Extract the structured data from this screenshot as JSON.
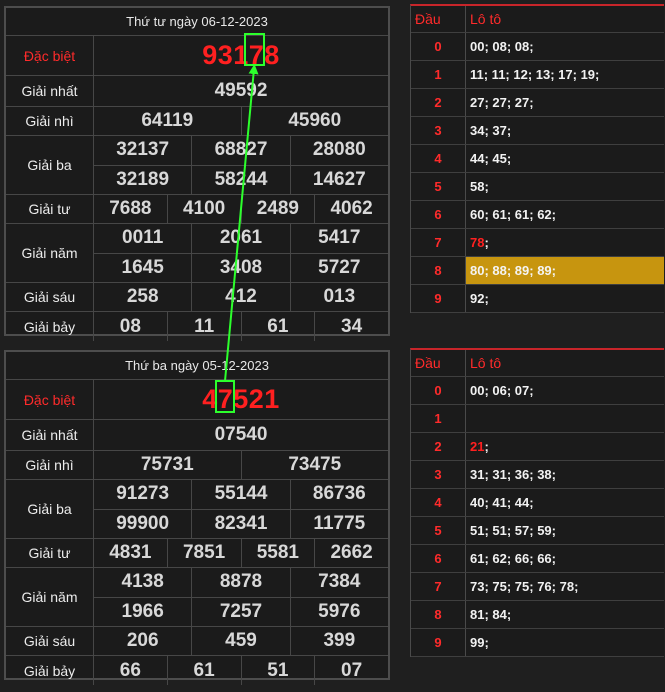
{
  "draws": [
    {
      "title": "Thứ tư ngày 06-12-2023",
      "rows": [
        {
          "label": "Đặc biệt",
          "values": [
            "93178"
          ]
        },
        {
          "label": "Giải nhất",
          "values": [
            "49592"
          ]
        },
        {
          "label": "Giải nhì",
          "values": [
            "64119",
            "45960"
          ]
        },
        {
          "label": "Giải ba",
          "values": [
            "32137",
            "68827",
            "28080",
            "32189",
            "58244",
            "14627"
          ]
        },
        {
          "label": "Giải tư",
          "values": [
            "7688",
            "4100",
            "2489",
            "4062"
          ]
        },
        {
          "label": "Giải năm",
          "values": [
            "0011",
            "2061",
            "5417",
            "1645",
            "3408",
            "5727"
          ]
        },
        {
          "label": "Giải sáu",
          "values": [
            "258",
            "412",
            "013"
          ]
        },
        {
          "label": "Giải bảy",
          "values": [
            "08",
            "11",
            "61",
            "34"
          ]
        }
      ],
      "loto": {
        "head_label": "Đầu",
        "values_label": "Lô tô",
        "rows": [
          {
            "dau": "0",
            "plain": "00; 08; 08;",
            "red": ""
          },
          {
            "dau": "1",
            "plain": "11; 11; 12; 13; 17; 19;",
            "red": ""
          },
          {
            "dau": "2",
            "plain": "27; 27; 27;",
            "red": ""
          },
          {
            "dau": "3",
            "plain": "34; 37;",
            "red": ""
          },
          {
            "dau": "4",
            "plain": "44; 45;",
            "red": ""
          },
          {
            "dau": "5",
            "plain": "58;",
            "red": ""
          },
          {
            "dau": "6",
            "plain": "60; 61; 61; 62;",
            "red": ""
          },
          {
            "dau": "7",
            "plain": ";",
            "red": "78"
          },
          {
            "dau": "8",
            "plain": "80; 88; 89; 89;",
            "red": ""
          },
          {
            "dau": "9",
            "plain": "92;",
            "red": ""
          }
        ]
      }
    },
    {
      "title": "Thứ ba ngày 05-12-2023",
      "rows": [
        {
          "label": "Đặc biệt",
          "values": [
            "47521"
          ]
        },
        {
          "label": "Giải nhất",
          "values": [
            "07540"
          ]
        },
        {
          "label": "Giải nhì",
          "values": [
            "75731",
            "73475"
          ]
        },
        {
          "label": "Giải ba",
          "values": [
            "91273",
            "55144",
            "86736",
            "99900",
            "82341",
            "11775"
          ]
        },
        {
          "label": "Giải tư",
          "values": [
            "4831",
            "7851",
            "5581",
            "2662"
          ]
        },
        {
          "label": "Giải năm",
          "values": [
            "4138",
            "8878",
            "7384",
            "1966",
            "7257",
            "5976"
          ]
        },
        {
          "label": "Giải sáu",
          "values": [
            "206",
            "459",
            "399"
          ]
        },
        {
          "label": "Giải bảy",
          "values": [
            "66",
            "61",
            "51",
            "07"
          ]
        }
      ],
      "loto": {
        "head_label": "Đầu",
        "values_label": "Lô tô",
        "rows": [
          {
            "dau": "0",
            "plain": "00; 06; 07;",
            "red": ""
          },
          {
            "dau": "1",
            "plain": "",
            "red": ""
          },
          {
            "dau": "2",
            "plain": ";",
            "red": "21"
          },
          {
            "dau": "3",
            "plain": "31; 31; 36; 38;",
            "red": ""
          },
          {
            "dau": "4",
            "plain": "40; 41; 44;",
            "red": ""
          },
          {
            "dau": "5",
            "plain": "51; 51; 57; 59;",
            "red": ""
          },
          {
            "dau": "6",
            "plain": "61; 62; 66; 66;",
            "red": ""
          },
          {
            "dau": "7",
            "plain": "73; 75; 75; 76; 78;",
            "red": ""
          },
          {
            "dau": "8",
            "plain": "81; 84;",
            "red": ""
          },
          {
            "dau": "9",
            "plain": "99;",
            "red": ""
          }
        ]
      }
    }
  ],
  "colors": {
    "special_red": "#ff2020",
    "highlight_gold": "#c7950f",
    "arrow_green": "#2cff2c"
  }
}
